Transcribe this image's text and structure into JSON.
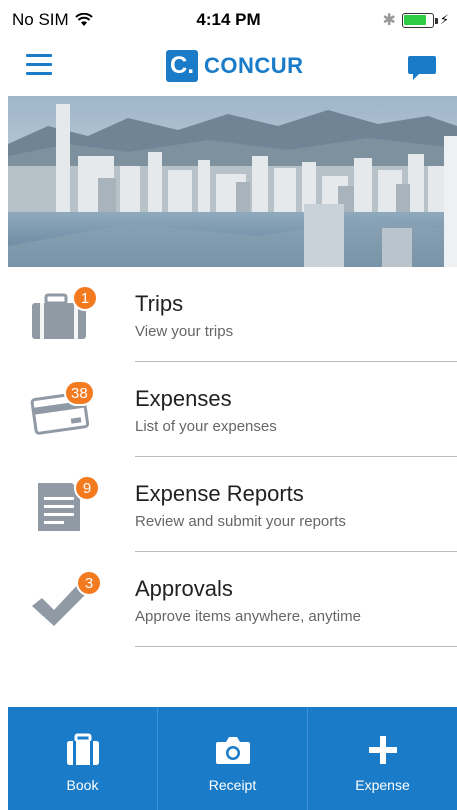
{
  "status_bar": {
    "carrier": "No SIM",
    "time": "4:14 PM",
    "battery_level": 0.8
  },
  "header": {
    "logo_letter": "C.",
    "logo_text": "CONCUR",
    "menu_icon": "hamburger-icon",
    "chat_icon": "chat-bubble-icon"
  },
  "menu": {
    "items": [
      {
        "title": "Trips",
        "subtitle": "View your trips",
        "badge": "1",
        "icon": "briefcase-icon"
      },
      {
        "title": "Expenses",
        "subtitle": "List of your expenses",
        "badge": "38",
        "icon": "credit-card-icon"
      },
      {
        "title": "Expense Reports",
        "subtitle": "Review and submit your reports",
        "badge": "9",
        "icon": "report-document-icon"
      },
      {
        "title": "Approvals",
        "subtitle": "Approve items anywhere, anytime",
        "badge": "3",
        "icon": "checkmark-icon"
      }
    ]
  },
  "tab_bar": {
    "tabs": [
      {
        "label": "Book",
        "icon": "suitcase-icon"
      },
      {
        "label": "Receipt",
        "icon": "camera-icon"
      },
      {
        "label": "Expense",
        "icon": "plus-icon"
      }
    ]
  },
  "colors": {
    "accent": "#1a7bc8",
    "badge": "#f47a20",
    "icon_gray": "#8f9aa5"
  }
}
